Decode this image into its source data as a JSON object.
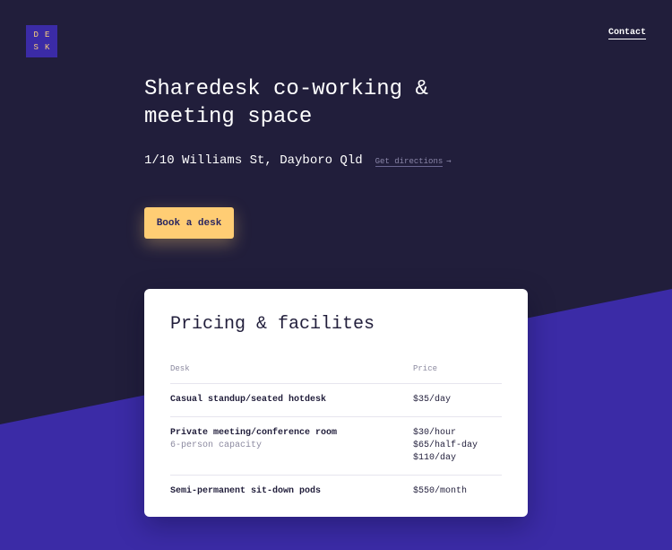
{
  "colors": {
    "background_top": "#211e3b",
    "background_wedge": "#3b2ba6",
    "accent_button": "#ffcd74",
    "card": "#ffffff"
  },
  "logo": {
    "letters": [
      "D",
      "E",
      "S",
      "K"
    ]
  },
  "nav": {
    "contact_label": "Contact"
  },
  "hero": {
    "title": "Sharedesk co-working & meeting space",
    "address": "1/10 Williams St, Dayboro Qld",
    "directions_label": "Get directions",
    "directions_arrow": "→",
    "book_button_label": "Book a desk"
  },
  "pricing": {
    "title": "Pricing & facilites",
    "headers": {
      "desk": "Desk",
      "price": "Price"
    },
    "rows": [
      {
        "desk": "Casual standup/seated hotdesk",
        "sub": "",
        "prices": [
          "$35/day"
        ]
      },
      {
        "desk": "Private meeting/conference room",
        "sub": "6-person capacity",
        "prices": [
          "$30/hour",
          "$65/half-day",
          "$110/day"
        ]
      },
      {
        "desk": "Semi-permanent sit-down pods",
        "sub": "",
        "prices": [
          "$550/month"
        ]
      }
    ]
  }
}
